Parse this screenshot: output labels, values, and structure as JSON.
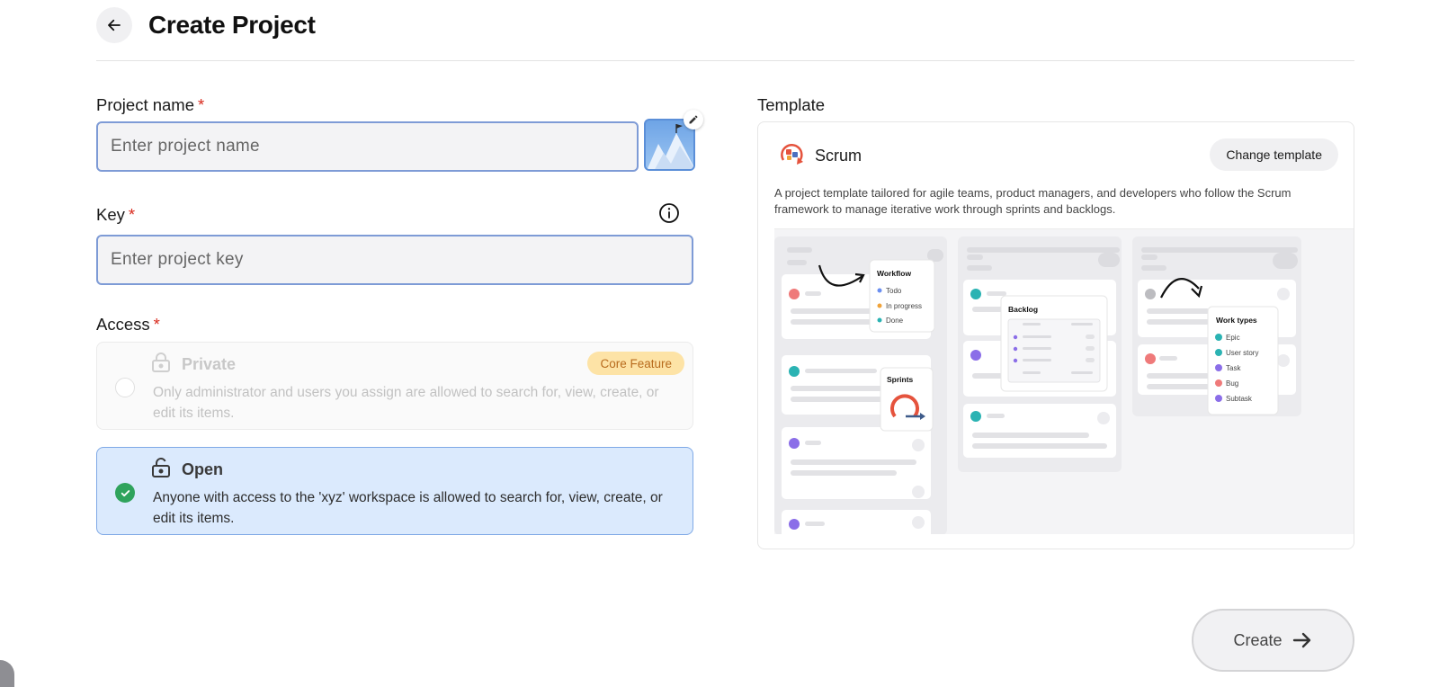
{
  "header": {
    "title": "Create Project",
    "back_icon": "arrow-left-icon"
  },
  "form": {
    "project_name": {
      "label": "Project name",
      "required_mark": "*",
      "placeholder": "Enter project name",
      "value": ""
    },
    "key": {
      "label": "Key",
      "required_mark": "*",
      "placeholder": "Enter project key",
      "value": ""
    },
    "access": {
      "label": "Access",
      "required_mark": "*",
      "options": [
        {
          "title": "Private",
          "description": "Only administrator and users you assign are allowed to search for, view, create, or edit its items.",
          "badge": "Core Feature",
          "selected": false,
          "disabled": true
        },
        {
          "title": "Open",
          "description": "Anyone with access to the 'xyz' workspace is allowed to search for, view, create, or edit its items.",
          "selected": true,
          "disabled": false
        }
      ]
    }
  },
  "template": {
    "label": "Template",
    "name": "Scrum",
    "change_label": "Change template",
    "description": "A project template tailored for agile teams, product managers, and developers who follow the Scrum framework to manage iterative work through sprints and backlogs.",
    "preview": {
      "workflow": {
        "title": "Workflow",
        "items": [
          "Todo",
          "In progress",
          "Done"
        ]
      },
      "sprints": {
        "title": "Sprints"
      },
      "backlog": {
        "title": "Backlog"
      },
      "work_types": {
        "title": "Work types",
        "items": [
          "Epic",
          "User story",
          "Task",
          "Bug",
          "Subtask"
        ]
      }
    }
  },
  "actions": {
    "create_label": "Create"
  },
  "colors": {
    "accent_border": "#7e9bd6",
    "selected_bg": "#dbeafd",
    "success": "#2fa35c",
    "required": "#d92d20",
    "badge_bg": "#fde3a6",
    "badge_text": "#b86b1d"
  }
}
